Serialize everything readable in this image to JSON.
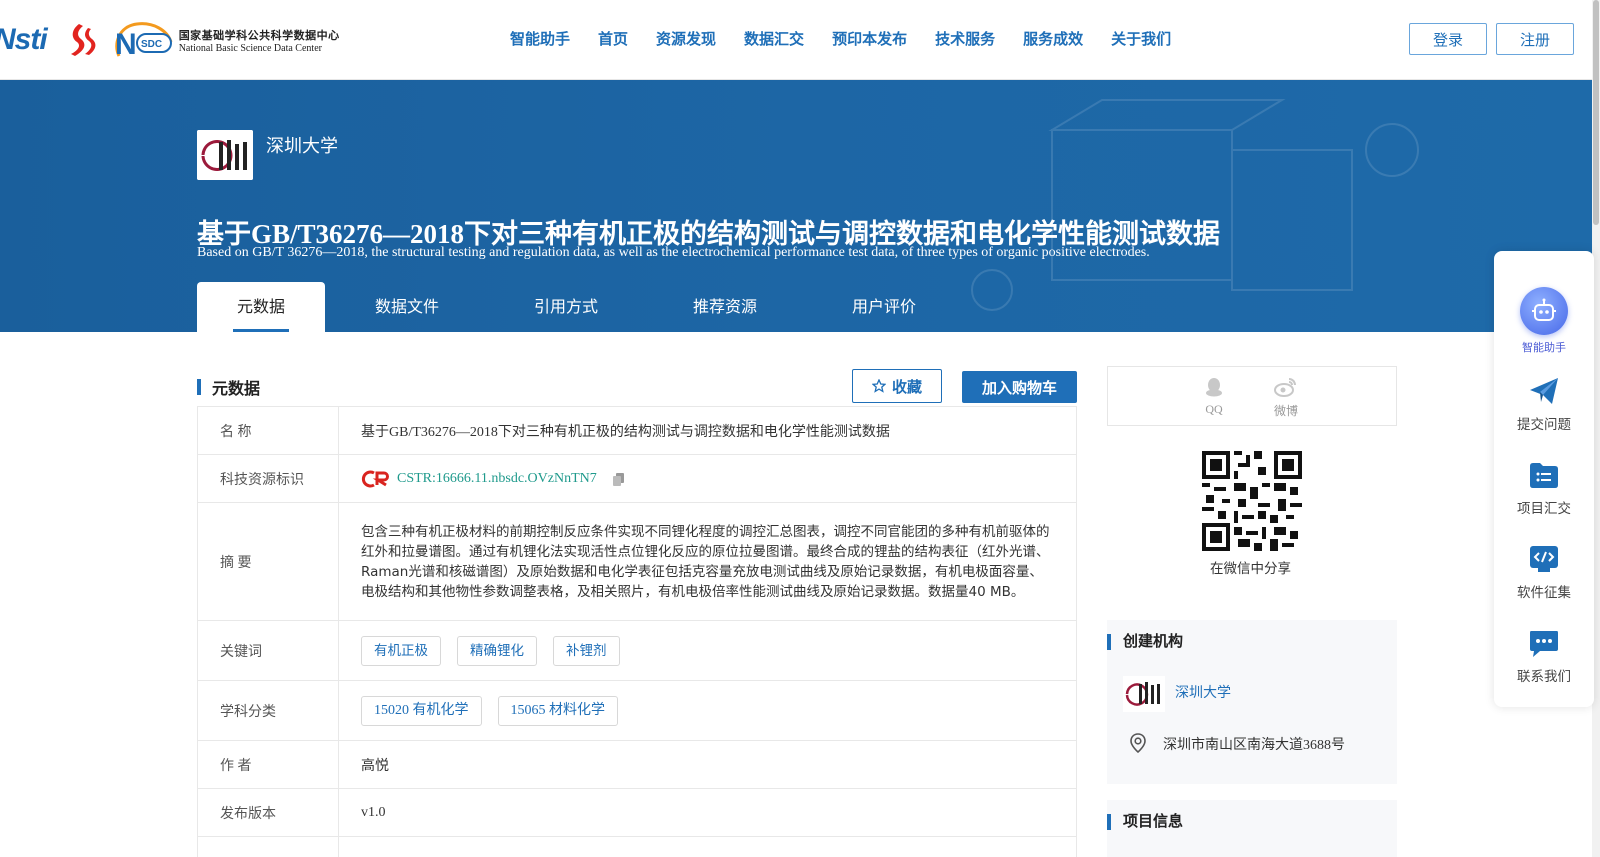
{
  "header": {
    "logo_nstl": "Nsti",
    "logo_nsdc_badge": "NSDC",
    "logo_nsdc_cn": "国家基础学科公共科学数据中心",
    "logo_nsdc_en": "National Basic Science Data Center",
    "nav": [
      "智能助手",
      "首页",
      "资源发现",
      "数据汇交",
      "预印本发布",
      "技术服务",
      "服务成效",
      "关于我们"
    ],
    "login_label": "登录",
    "register_label": "注册"
  },
  "banner": {
    "institution": "深圳大学",
    "title": "基于GB/T36276—2018下对三种有机正极的结构测试与调控数据和电化学性能测试数据",
    "subtitle": "Based on GB/T 36276—2018, the structural testing and regulation data, as well as the electrochemical performance test data, of three types of organic positive electrodes.",
    "tabs": [
      "元数据",
      "数据文件",
      "引用方式",
      "推荐资源",
      "用户评价"
    ],
    "active_tab": 0
  },
  "metadata": {
    "section_title": "元数据",
    "favorite_label": "收藏",
    "cart_label": "加入购物车",
    "rows": {
      "name_key": "名  称",
      "name_value": "基于GB/T36276—2018下对三种有机正极的结构测试与调控数据和电化学性能测试数据",
      "id_key": "科技资源标识",
      "id_value": "CSTR:16666.11.nbsdc.OVzNnTN7",
      "abstract_key": "摘  要",
      "abstract_value": "包含三种有机正极材料的前期控制反应条件实现不同锂化程度的调控汇总图表，调控不同官能团的多种有机前驱体的红外和拉曼谱图。通过有机锂化法实现活性点位锂化反应的原位拉曼图谱。最终合成的锂盐的结构表征（红外光谱、Raman光谱和核磁谱图）及原始数据和电化学表征包括克容量充放电测试曲线及原始记录数据，有机电极面容量、电极结构和其他物性参数调整表格，及相关照片，有机电极倍率性能测试曲线及原始记录数据。数据量40 MB。",
      "keywords_key": "关键词",
      "keywords": [
        "有机正极",
        "精确锂化",
        "补锂剂"
      ],
      "subject_key": "学科分类",
      "subjects": [
        "15020 有机化学",
        "15065 材料化学"
      ],
      "author_key": "作  者",
      "author_value": "高悦",
      "version_key": "发布版本",
      "version_value": "v1.0"
    }
  },
  "share": {
    "qq_label": "QQ",
    "weibo_label": "微博",
    "wechat_caption": "在微信中分享"
  },
  "org_card": {
    "title": "创建机构",
    "name": "深圳大学",
    "address": "深圳市南山区南海大道3688号"
  },
  "project_card": {
    "title": "项目信息"
  },
  "float_panel": {
    "ai_label": "智能助手",
    "items": [
      "提交问题",
      "项目汇交",
      "软件征集",
      "联系我们"
    ]
  },
  "colors": {
    "brand_blue": "#1f6fb8",
    "banner_blue": "#1a5f9c",
    "cstr_green": "#1f9a8c"
  }
}
